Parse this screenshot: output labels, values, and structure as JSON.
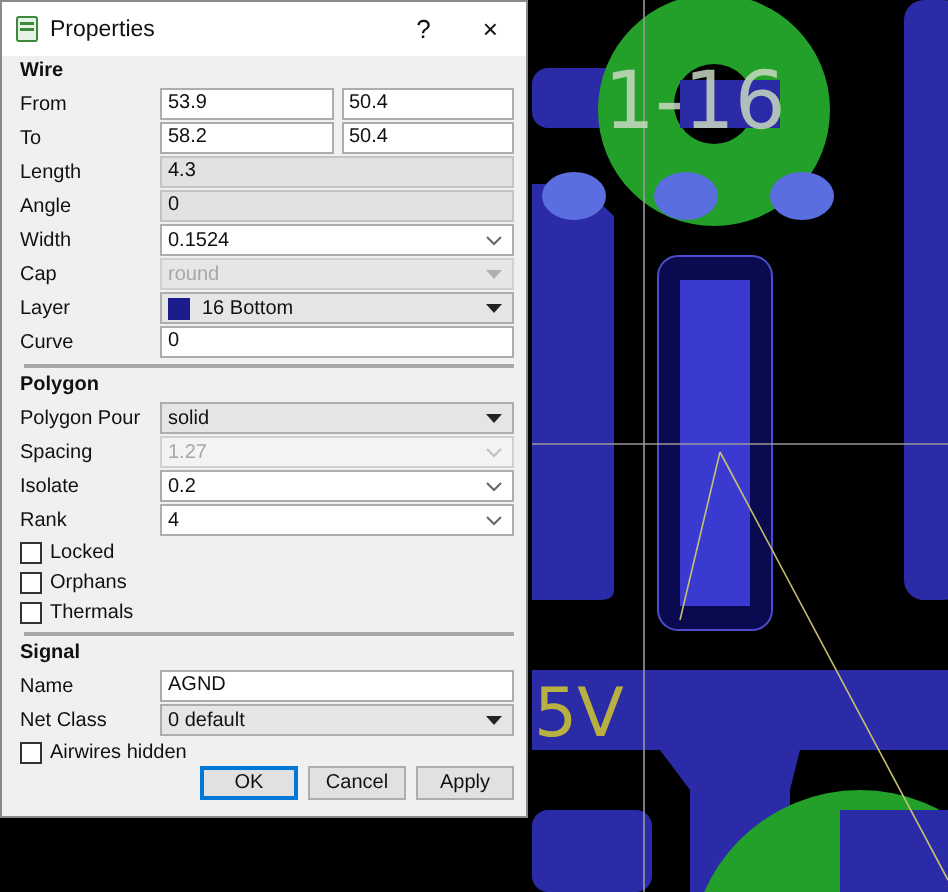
{
  "dialog": {
    "title": "Properties",
    "help": "?",
    "close": "×",
    "sections": [
      {
        "heading": "Wire",
        "rows": [
          {
            "kind": "pair",
            "label": "From",
            "values": [
              "53.9",
              "50.4"
            ]
          },
          {
            "kind": "pair",
            "label": "To",
            "values": [
              "58.2",
              "50.4"
            ]
          },
          {
            "kind": "field",
            "label": "Length",
            "value": "4.3",
            "readonly": true
          },
          {
            "kind": "field",
            "label": "Angle",
            "value": "0",
            "readonly": true
          },
          {
            "kind": "combo",
            "label": "Width",
            "value": "0.1524",
            "disabled": false
          },
          {
            "kind": "select",
            "label": "Cap",
            "value": "round",
            "disabled": true
          },
          {
            "kind": "select",
            "label": "Layer",
            "value": "16 Bottom",
            "disabled": false,
            "color": "#1c1c8e"
          },
          {
            "kind": "field",
            "label": "Curve",
            "value": "0",
            "readonly": false
          }
        ]
      },
      {
        "heading": "Polygon",
        "rows": [
          {
            "kind": "select",
            "label": "Polygon Pour",
            "value": "solid",
            "disabled": false
          },
          {
            "kind": "combo",
            "label": "Spacing",
            "value": "1.27",
            "disabled": true
          },
          {
            "kind": "combo",
            "label": "Isolate",
            "value": "0.2",
            "disabled": false
          },
          {
            "kind": "combo",
            "label": "Rank",
            "value": "4",
            "disabled": false
          },
          {
            "kind": "checkbox",
            "label": "Locked",
            "checked": false
          },
          {
            "kind": "checkbox",
            "label": "Orphans",
            "checked": false
          },
          {
            "kind": "checkbox",
            "label": "Thermals",
            "checked": false
          }
        ]
      },
      {
        "heading": "Signal",
        "rows": [
          {
            "kind": "field",
            "label": "Name",
            "value": "AGND",
            "readonly": false
          },
          {
            "kind": "select",
            "label": "Net Class",
            "value": "0 default",
            "disabled": false
          },
          {
            "kind": "checkbox",
            "label": "Airwires hidden",
            "checked": false
          }
        ]
      }
    ],
    "buttons": [
      {
        "label": "OK",
        "default": true
      },
      {
        "label": "Cancel",
        "default": false
      },
      {
        "label": "Apply",
        "default": false
      }
    ]
  },
  "canvas": {
    "labels": [
      {
        "kind": "pad",
        "text": "1-16"
      },
      {
        "kind": "net",
        "text": "5V"
      }
    ]
  }
}
